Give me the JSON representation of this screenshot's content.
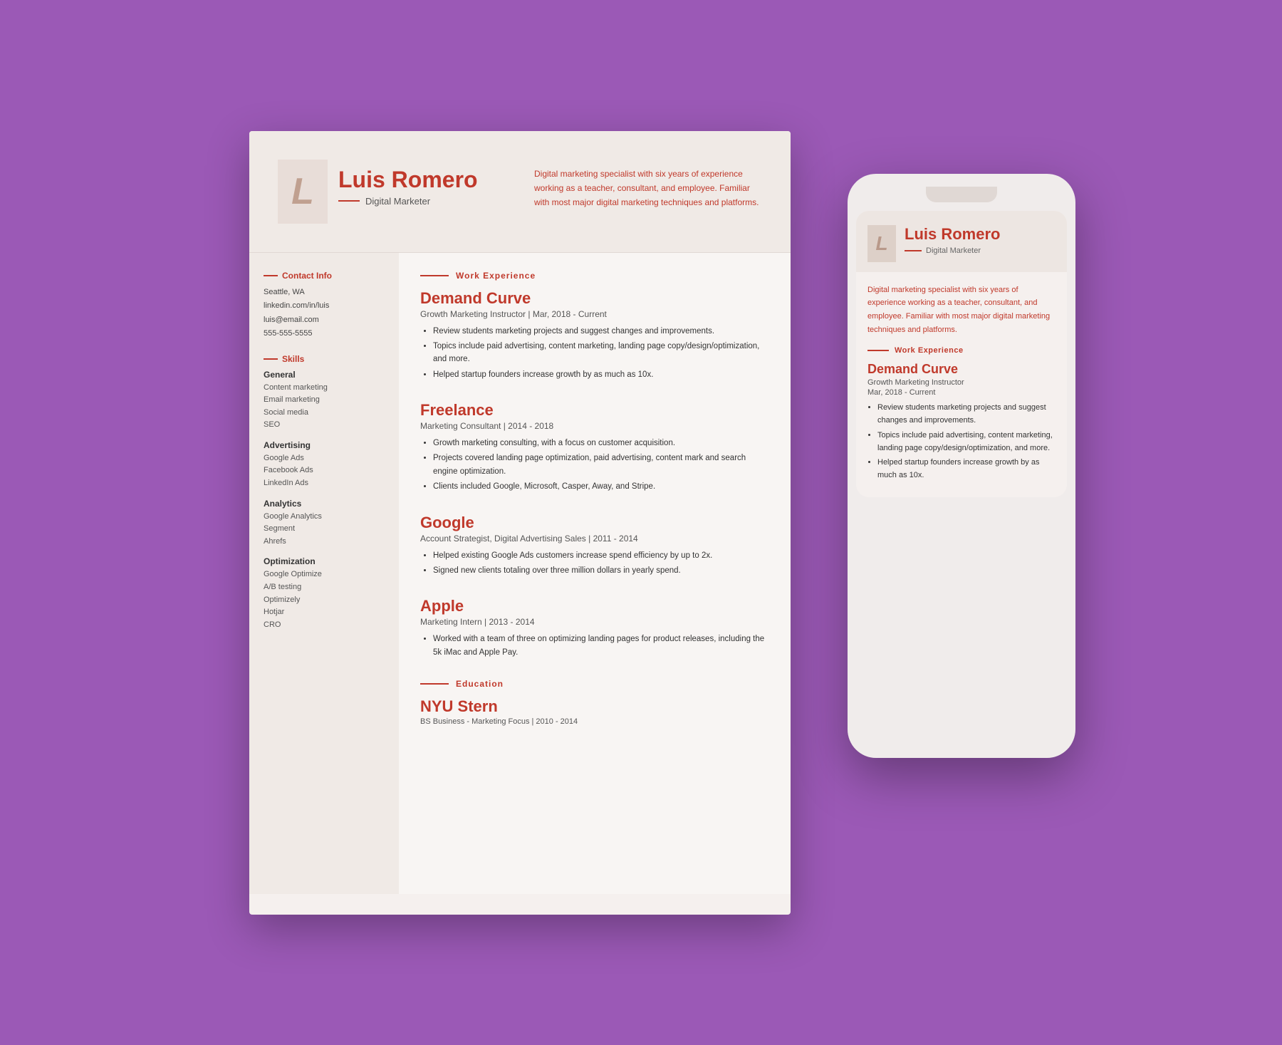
{
  "resume": {
    "name": "Luis Romero",
    "title": "Digital Marketer",
    "monogram": "L",
    "bio": "Digital marketing specialist with six years of experience working as a teacher, consultant, and employee. Familiar with most major digital marketing techniques and platforms.",
    "contact": {
      "section_title": "Contact Info",
      "items": [
        "Seattle, WA",
        "linkedin.com/in/luis",
        "luis@email.com",
        "555-555-5555"
      ]
    },
    "skills": {
      "section_title": "Skills",
      "categories": [
        {
          "title": "General",
          "items": [
            "Content marketing",
            "Email marketing",
            "Social media",
            "SEO"
          ]
        },
        {
          "title": "Advertising",
          "items": [
            "Google Ads",
            "Facebook Ads",
            "LinkedIn Ads"
          ]
        },
        {
          "title": "Analytics",
          "items": [
            "Google Analytics",
            "Segment",
            "Ahrefs"
          ]
        },
        {
          "title": "Optimization",
          "items": [
            "Google Optimize",
            "A/B testing",
            "Optimizely",
            "Hotjar",
            "CRO"
          ]
        }
      ]
    },
    "work_experience": {
      "section_label": "Work Experience",
      "entries": [
        {
          "company": "Demand Curve",
          "role": "Growth Marketing Instructor | Mar, 2018 - Current",
          "bullets": [
            "Review students marketing projects and suggest changes and improvements.",
            "Topics include paid advertising, content marketing, landing page copy/design/optimization, and more.",
            "Helped startup founders increase growth by as much as 10x."
          ]
        },
        {
          "company": "Freelance",
          "role": "Marketing Consultant | 2014 - 2018",
          "bullets": [
            "Growth marketing consulting, with a focus on customer acquisition.",
            "Projects covered landing page optimization, paid advertising, content marketing and search engine optimization.",
            "Clients included Google, Microsoft, Casper, Away, and Stripe."
          ]
        },
        {
          "company": "Google",
          "role": "Account Strategist, Digital Advertising Sales | 2011 - 2014",
          "bullets": [
            "Helped existing Google Ads customers increase spend efficiency by up to 2x.",
            "Signed new clients totaling over three million dollars in yearly spend."
          ]
        },
        {
          "company": "Apple",
          "role": "Marketing Intern | 2013 - 2014",
          "bullets": [
            "Worked with a team of three on optimizing landing pages for product releases, including the 5k iMac and Apple Pay."
          ]
        }
      ]
    },
    "education": {
      "section_label": "Education",
      "school": "NYU Stern",
      "degree": "BS Business - Marketing Focus | 2010 - 2014"
    }
  },
  "mobile": {
    "name": "Luis Romero",
    "title": "Digital Marketer",
    "monogram": "L",
    "bio": "Digital marketing specialist with six years of experience working as a teacher, consultant, and employee. Familiar with most major digital marketing techniques and platforms.",
    "work_experience_label": "Work Experience",
    "company": "Demand Curve",
    "role": "Growth Marketing Instructor",
    "date": "Mar, 2018 - Current",
    "bullets": [
      "Review students marketing projects and suggest changes and improvements.",
      "Topics include paid advertising, content marketing, landing page copy/design/optimization, and more.",
      "Helped startup founders increase growth by as much as 10x."
    ]
  }
}
